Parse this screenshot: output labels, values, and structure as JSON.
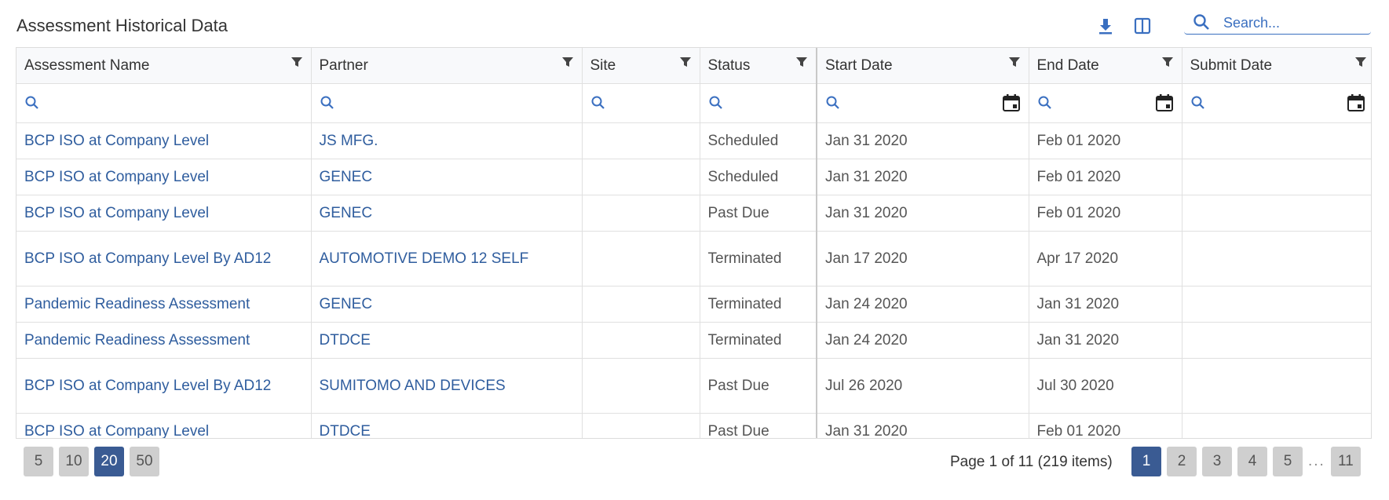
{
  "header": {
    "title": "Assessment Historical Data",
    "search_placeholder": "Search..."
  },
  "table": {
    "columns": [
      {
        "label": "Assessment Name"
      },
      {
        "label": "Partner"
      },
      {
        "label": "Site"
      },
      {
        "label": "Status"
      },
      {
        "label": "Start Date"
      },
      {
        "label": "End Date"
      },
      {
        "label": "Submit Date"
      }
    ],
    "rows": [
      {
        "name": "BCP ISO at Company Level",
        "partner": "JS MFG.",
        "site": "",
        "status": "Scheduled",
        "start": "Jan 31 2020",
        "end": "Feb 01 2020",
        "submit": ""
      },
      {
        "name": "BCP ISO at Company Level",
        "partner": "GENEC",
        "site": "",
        "status": "Scheduled",
        "start": "Jan 31 2020",
        "end": "Feb 01 2020",
        "submit": ""
      },
      {
        "name": "BCP ISO at Company Level",
        "partner": "GENEC",
        "site": "",
        "status": "Past Due",
        "start": "Jan 31 2020",
        "end": "Feb 01 2020",
        "submit": ""
      },
      {
        "name": "BCP ISO at Company Level By AD12",
        "partner": "AUTOMOTIVE DEMO 12 SELF",
        "site": "",
        "status": "Terminated",
        "start": "Jan 17 2020",
        "end": "Apr 17 2020",
        "submit": ""
      },
      {
        "name": "Pandemic Readiness Assessment",
        "partner": "GENEC",
        "site": "",
        "status": "Terminated",
        "start": "Jan 24 2020",
        "end": "Jan 31 2020",
        "submit": ""
      },
      {
        "name": "Pandemic Readiness Assessment",
        "partner": "DTDCE",
        "site": "",
        "status": "Terminated",
        "start": "Jan 24 2020",
        "end": "Jan 31 2020",
        "submit": ""
      },
      {
        "name": "BCP ISO at Company Level By AD12",
        "partner": "SUMITOMO AND DEVICES",
        "site": "",
        "status": "Past Due",
        "start": "Jul 26 2020",
        "end": "Jul 30 2020",
        "submit": ""
      },
      {
        "name": "BCP ISO at Company Level",
        "partner": "DTDCE",
        "site": "",
        "status": "Past Due",
        "start": "Jan 31 2020",
        "end": "Feb 01 2020",
        "submit": ""
      }
    ]
  },
  "pager": {
    "page_sizes": [
      "5",
      "10",
      "20",
      "50"
    ],
    "active_page_size": "20",
    "info": "Page 1 of 11 (219 items)",
    "pages": [
      "1",
      "2",
      "3",
      "4",
      "5"
    ],
    "ellipsis": "...",
    "last_page": "11",
    "active_page": "1"
  },
  "colors": {
    "accent": "#3a6fc0",
    "link": "#2f5d9e",
    "active_button": "#3a5b93",
    "inactive_button": "#cfcfcf"
  }
}
